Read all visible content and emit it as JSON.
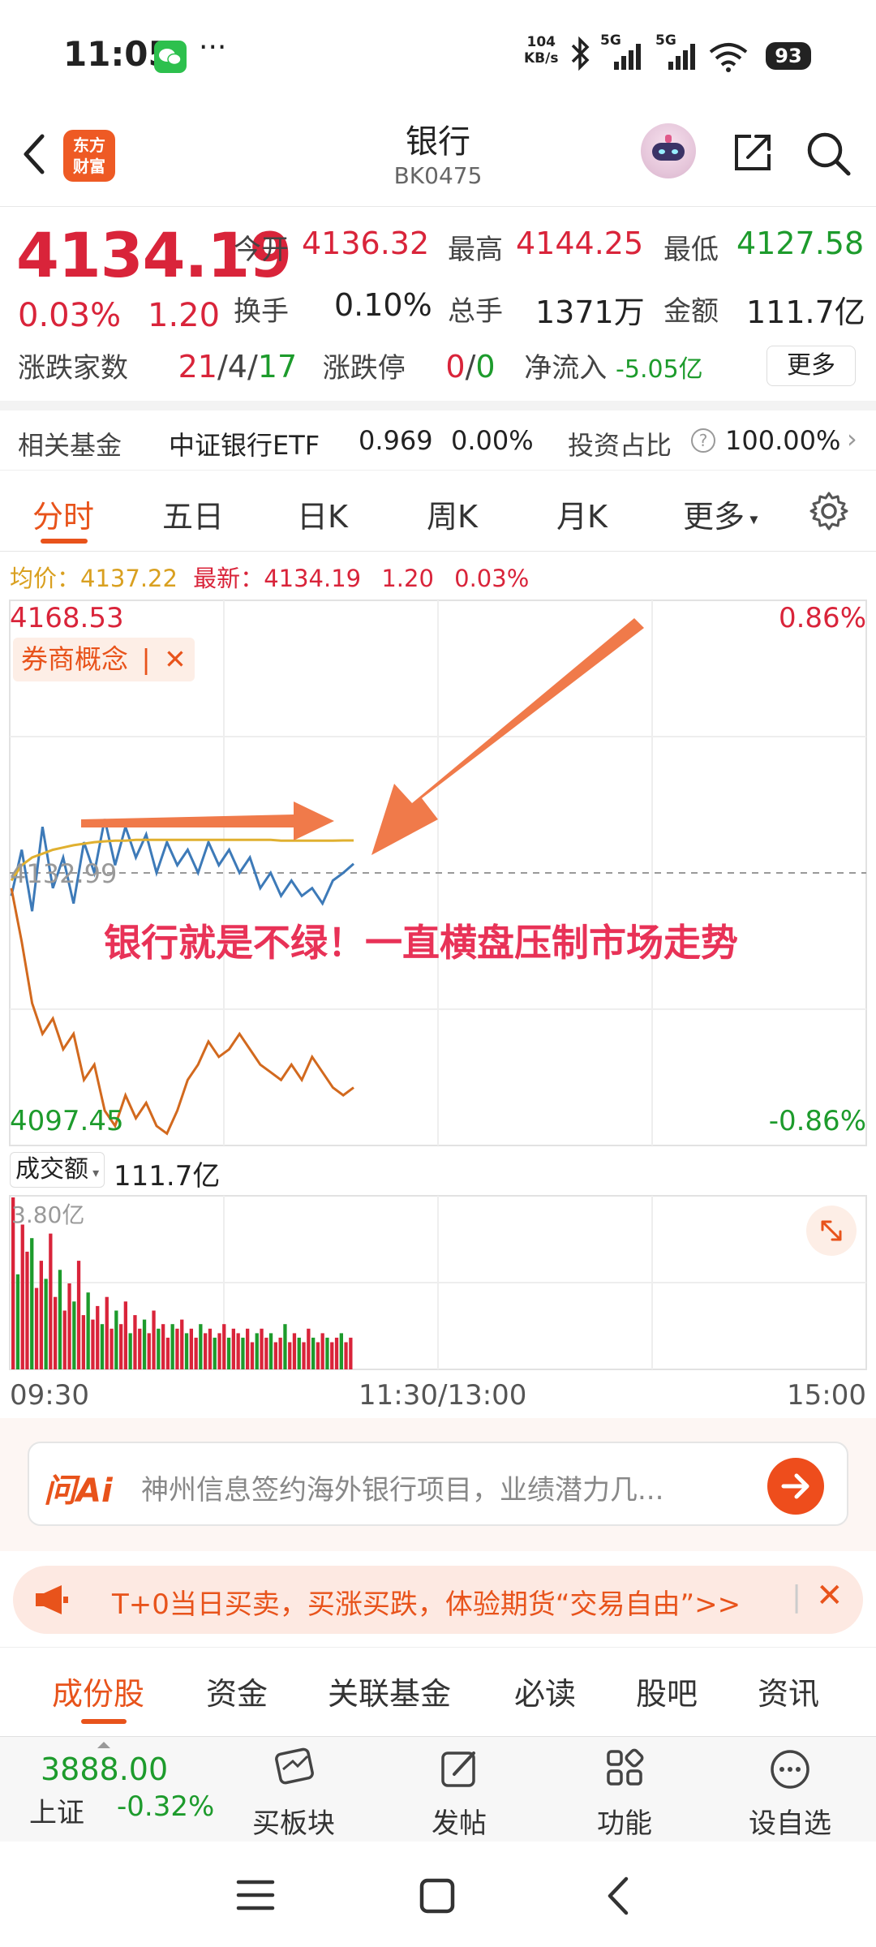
{
  "status_bar": {
    "time": "11:05",
    "net_speed_value": "104",
    "net_speed_unit": "KB/s",
    "signal_1": "5G",
    "signal_2": "5G",
    "battery": "93"
  },
  "header": {
    "logo_line1": "东方",
    "logo_line2": "财富",
    "title": "银行",
    "code": "BK0475"
  },
  "quote": {
    "price": "4134.19",
    "change_pct": "0.03%",
    "change_abs": "1.20",
    "open_label": "今开",
    "open_value": "4136.32",
    "high_label": "最高",
    "high_value": "4144.25",
    "low_label": "最低",
    "low_value": "4127.58",
    "turnover_label": "换手",
    "turnover_value": "0.10%",
    "volume_label": "总手",
    "volume_value": "1371万",
    "amount_label": "金额",
    "amount_value": "111.7亿",
    "adv_label": "涨跌家数",
    "adv_up": "21",
    "adv_flat": "4",
    "adv_down": "17",
    "limit_label": "涨跌停",
    "limit_up": "0",
    "limit_down": "0",
    "netflow_label": "净流入",
    "netflow_value": "-5.05亿",
    "more": "更多"
  },
  "fund_row": {
    "label": "相关基金",
    "fund_name": "中证银行ETF",
    "fund_price": "0.969",
    "fund_change": "0.00%",
    "ratio_label": "投资占比",
    "ratio_value": "100.00%"
  },
  "tabs": [
    "分时",
    "五日",
    "日K",
    "周K",
    "月K",
    "更多"
  ],
  "info_line": {
    "avg_label": "均价：",
    "avg_value": "4137.22",
    "latest_label": "最新：",
    "latest_value": "4134.19",
    "change_abs": "1.20",
    "change_pct": "0.03%"
  },
  "chart_labels": {
    "top_price": "4168.53",
    "top_pct": "0.86%",
    "mid_price": "4132.99",
    "bottom_price": "4097.45",
    "bottom_pct": "-0.86%",
    "concept_tag": "券商概念",
    "annotation": "银行就是不绿！一直横盘压制市场走势",
    "volume_selector": "成交额",
    "volume_total": "111.7亿",
    "volume_max": "3.80亿",
    "time_start": "09:30",
    "time_mid": "11:30/13:00",
    "time_end": "15:00"
  },
  "chart_data": {
    "type": "line",
    "ylim": [
      4097.45,
      4168.53
    ],
    "reference": 4132.99,
    "series": [
      {
        "values": [
          4130,
          4136,
          4128,
          4139,
          4131,
          4135,
          4129,
          4137,
          4133,
          4140,
          4134,
          4139,
          4135,
          4138,
          4133,
          4137,
          4134,
          4136,
          4133,
          4137,
          4134,
          4136,
          4133,
          4135,
          4131,
          4133,
          4130,
          4132,
          4130,
          4131,
          4129,
          4132,
          4133,
          4134.19
        ]
      },
      {
        "values": [
          4132,
          4134,
          4135,
          4135.5,
          4136,
          4136.3,
          4136.6,
          4136.8,
          4137,
          4137.1,
          4137.2,
          4137.2,
          4137.3,
          4137.3,
          4137.3,
          4137.3,
          4137.3,
          4137.3,
          4137.3,
          4137.3,
          4137.3,
          4137.3,
          4137.3,
          4137.3,
          4137.3,
          4137.3,
          4137.2,
          4137.2,
          4137.2,
          4137.2,
          4137.2,
          4137.2,
          4137.22,
          4137.22
        ]
      },
      {
        "values": [
          4131,
          4124,
          4116,
          4112,
          4114,
          4110,
          4112,
          4106,
          4108,
          4102,
          4100,
          4104,
          4101,
          4103,
          4100,
          4099,
          4102,
          4106,
          4108,
          4111,
          4109,
          4110,
          4112,
          4110,
          4108,
          4107,
          4106,
          4108,
          4106,
          4109,
          4107,
          4105,
          4104,
          4105
        ]
      }
    ],
    "volume": [
      3.8,
      2.1,
      3.2,
      2.6,
      2.9,
      1.8,
      2.4,
      2.0,
      3.0,
      1.6,
      2.2,
      1.3,
      1.9,
      1.5,
      2.4,
      1.2,
      1.7,
      1.1,
      1.4,
      1.0,
      1.6,
      0.9,
      1.3,
      1.0,
      1.5,
      0.8,
      1.2,
      0.9,
      1.1,
      0.8,
      1.3,
      0.9,
      1.0,
      0.7,
      1.0,
      0.9,
      1.1,
      0.8,
      0.9,
      0.7,
      1.0,
      0.8,
      0.9,
      0.7,
      0.8,
      1.0,
      0.7,
      0.9,
      0.8,
      0.7,
      0.9,
      0.6,
      0.8,
      0.9,
      0.7,
      0.8,
      0.6,
      0.7,
      1.0,
      0.6,
      0.8,
      0.7,
      0.6,
      0.9,
      0.7,
      0.6,
      0.8,
      0.7,
      0.6,
      0.7,
      0.8,
      0.6,
      0.7
    ]
  },
  "ai_bar": {
    "brand": "问Ai",
    "placeholder": "神州信息签约海外银行项目，业绩潜力几..."
  },
  "promo": {
    "text": "T+0当日买卖，买涨买跌，体验期货“交易自由”>>"
  },
  "sub_tabs": [
    "成份股",
    "资金",
    "关联基金",
    "必读",
    "股吧",
    "资讯"
  ],
  "toolbar": {
    "index_value": "3888.00",
    "index_name": "上证",
    "index_change": "-0.32%",
    "buy_sector": "买板块",
    "post": "发帖",
    "functions": "功能",
    "add_watch": "设自选"
  },
  "colors": {
    "up": "#d9243a",
    "down": "#1d9b2c",
    "accent": "#e8531b",
    "price_line": "#3d7ab8",
    "avg_line": "#e0b030",
    "related_line": "#d2691e",
    "arrow": "#f07a4a"
  }
}
